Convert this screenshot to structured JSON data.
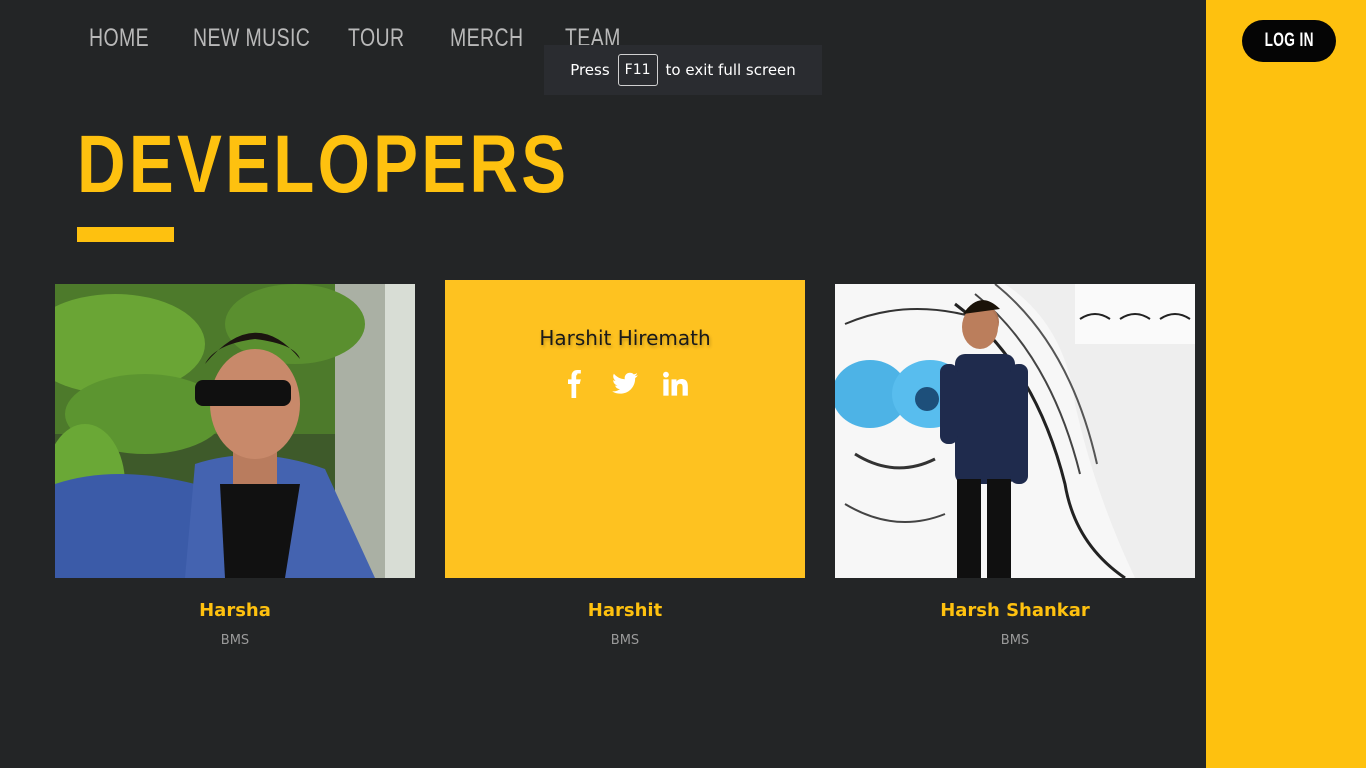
{
  "nav": {
    "items": [
      {
        "label": "HOME"
      },
      {
        "label": "NEW MUSIC"
      },
      {
        "label": "TOUR"
      },
      {
        "label": "MERCH"
      },
      {
        "label": "TEAM"
      }
    ]
  },
  "toast": {
    "prefix": "Press",
    "key": "F11",
    "suffix": "to exit full screen"
  },
  "sidebar": {
    "login_label": "LOG IN"
  },
  "page": {
    "title": "DEVELOPERS"
  },
  "team": [
    {
      "name": "Harsha",
      "org": "BMS"
    },
    {
      "name": "Harshit",
      "org": "BMS",
      "overlay_name": "Harshit Hiremath",
      "socials": [
        "facebook-icon",
        "twitter-icon",
        "linkedin-icon"
      ]
    },
    {
      "name": "Harsh Shankar",
      "org": "BMS"
    }
  ],
  "colors": {
    "accent": "#fec10f",
    "background": "#232526",
    "nav_text": "#b9b9b9"
  }
}
